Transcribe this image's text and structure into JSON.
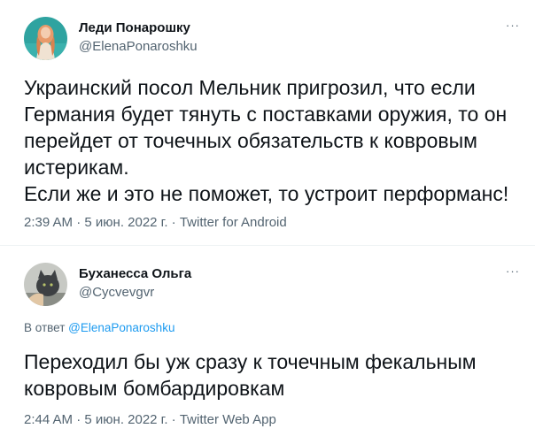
{
  "tweets": [
    {
      "display_name": "Леди Понарошку",
      "handle": "@ElenaPonaroshku",
      "more_label": "···",
      "text": "Украинский посол Мельник пригрозил, что если\nГермания будет тянуть с поставками оружия, то он\nперейдет от точечных обязательств к ковровым\nистерикам.\nЕсли же и это не поможет, то устроит перформанс!",
      "time": "2:39 AM",
      "date": "5 июн. 2022 г.",
      "source": "Twitter for Android",
      "sep": " · "
    },
    {
      "display_name": "Буханесса Ольга",
      "handle": "@Cycvevgvr",
      "more_label": "···",
      "reply_prefix": "В ответ ",
      "reply_to": "@ElenaPonaroshku",
      "text": "Переходил бы уж сразу к точечным фекальным\nковровым бомбардировкам",
      "time": "2:44 AM",
      "date": "5 июн. 2022 г.",
      "source": "Twitter Web App",
      "sep": " · "
    }
  ],
  "colors": {
    "text": "#0f1419",
    "secondary": "#536471",
    "link": "#1d9bf0",
    "divider": "#eff3f4"
  },
  "icons": {
    "more": "more-horizontal-icon"
  }
}
